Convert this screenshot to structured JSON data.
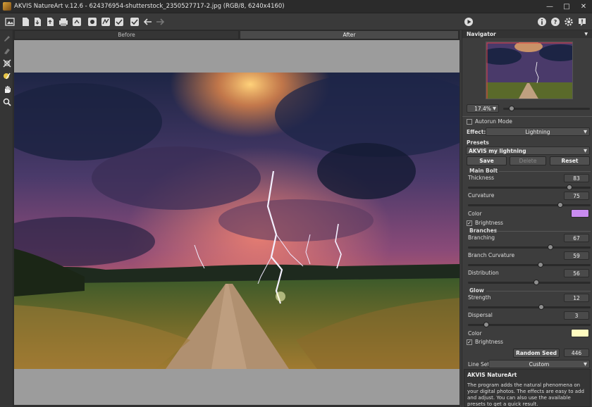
{
  "window": {
    "title": "AKVIS NatureArt v.12.6 - 624376954-shutterstock_2350527717-2.jpg (RGB/8, 6240x4160)",
    "controls": [
      "minimize-icon",
      "maximize-icon",
      "close-icon"
    ]
  },
  "toolbar": {
    "left_icons": [
      "open-image-icon",
      "save-icon",
      "export-icon",
      "batch-icon",
      "print-icon",
      "share-icon",
      "tool-icon-a",
      "tool-icon-b",
      "tool-icon-c",
      "tool-icon-d",
      "check-icon",
      "undo-icon",
      "redo-icon"
    ],
    "right_icons": [
      "run-icon",
      "info-icon",
      "help-icon",
      "settings-icon",
      "notification-icon"
    ]
  },
  "left_tools": [
    "brush-icon",
    "eraser-icon",
    "crop-icon",
    "sky-brush-icon",
    "hand-icon",
    "zoom-icon"
  ],
  "tabs": {
    "before": "Before",
    "after": "After"
  },
  "navigator": {
    "title": "Navigator",
    "zoom": "17.4%",
    "zoom_level": 0.1
  },
  "settings": {
    "autorun_label": "Autorun Mode",
    "autorun_checked": false,
    "effect_label": "Effect:",
    "effect_value": "Lightning",
    "presets_label": "Presets",
    "preset_value": "AKVIS my lightning",
    "save_label": "Save",
    "delete_label": "Delete",
    "reset_label": "Reset",
    "main_bolt": {
      "title": "Main Bolt",
      "thickness_label": "Thickness",
      "thickness": "83",
      "curvature_label": "Curvature",
      "curvature": "75",
      "color_label": "Color",
      "color": "#c98cf0",
      "brightness_label": "Brightness",
      "brightness_checked": true
    },
    "branches": {
      "title": "Branches",
      "branching_label": "Branching",
      "branching": "67",
      "branch_curvature_label": "Branch Curvature",
      "branch_curvature": "59",
      "distribution_label": "Distribution",
      "distribution": "56"
    },
    "glow": {
      "title": "Glow",
      "strength_label": "Strength",
      "strength": "12",
      "dispersal_label": "Dispersal",
      "dispersal": "3",
      "color_label": "Color",
      "color": "#fffbc0",
      "brightness_label": "Brightness",
      "brightness_checked": true
    },
    "random_seed_label": "Random Seed",
    "random_seed": "446",
    "line_set_label": "Line Set",
    "line_set_value": "Custom"
  },
  "info": {
    "title": "AKVIS NatureArt",
    "text": "The program adds the natural phenomena on your digital photos. The effects are easy to add and adjust. You can also use the available presets to get a quick result."
  }
}
